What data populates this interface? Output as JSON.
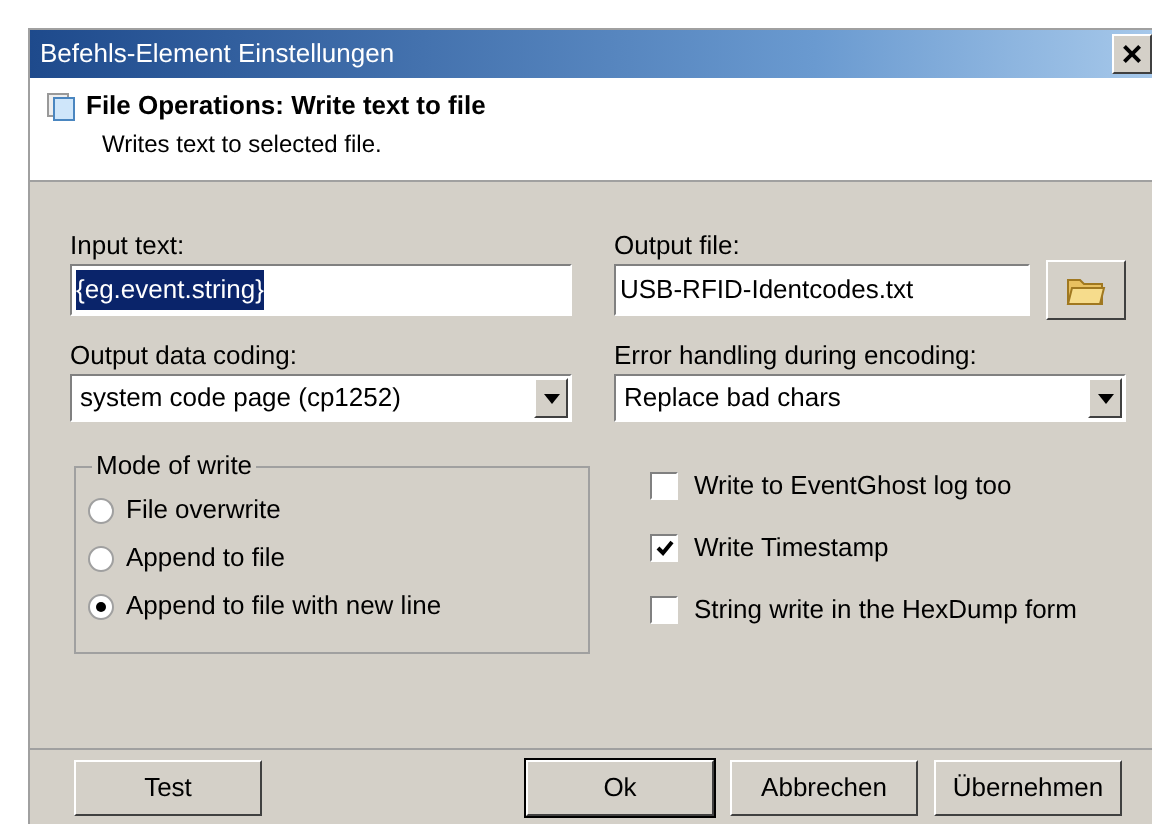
{
  "window": {
    "title": "Befehls-Element Einstellungen",
    "close": "×"
  },
  "header": {
    "title": "File Operations: Write text to file",
    "description": "Writes text to selected file."
  },
  "input_text": {
    "label": "Input text:",
    "value": "{eg.event.string}",
    "text_selected": true
  },
  "output_file": {
    "label": "Output file:",
    "value": "USB-RFID-Identcodes.txt"
  },
  "output_coding": {
    "label": "Output data coding:",
    "value": "system code page (cp1252)"
  },
  "error_handling": {
    "label": "Error handling during encoding:",
    "value": "Replace bad chars"
  },
  "mode_of_write": {
    "title": "Mode of write",
    "options": [
      {
        "label": "File overwrite",
        "selected": false
      },
      {
        "label": "Append to file",
        "selected": false
      },
      {
        "label": "Append to file with new line",
        "selected": true
      }
    ]
  },
  "options": [
    {
      "label": "Write to EventGhost log too",
      "checked": false
    },
    {
      "label": "Write Timestamp",
      "checked": true
    },
    {
      "label": "String write in the HexDump form",
      "checked": false
    }
  ],
  "buttons": [
    {
      "label": "Test",
      "default": false
    },
    {
      "label": "Ok",
      "default": true
    },
    {
      "label": "Abbrechen",
      "default": false
    },
    {
      "label": "Übernehmen",
      "default": false
    }
  ]
}
